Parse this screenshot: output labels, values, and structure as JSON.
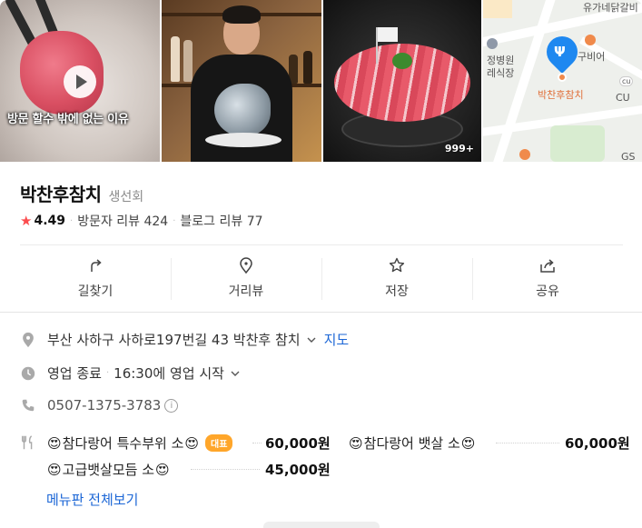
{
  "photos": {
    "video_caption": "방문 할수 밖에 없는 이유",
    "photo_count": "999+",
    "map": {
      "labels": {
        "top_right": "유가네닭갈비",
        "left_mid": "정병원",
        "left_mid2": "레식장",
        "right_mid": "구비어",
        "pin_label": "박찬후참치",
        "cu": "CU",
        "bottom_right": "GS"
      }
    }
  },
  "place": {
    "name": "박찬후참치",
    "category": "생선회",
    "rating": "4.49",
    "visitor_reviews": "방문자 리뷰 424",
    "blog_reviews": "블로그 리뷰 77"
  },
  "actions": {
    "directions": "길찾기",
    "street_view": "거리뷰",
    "save": "저장",
    "share": "공유"
  },
  "info": {
    "address": "부산 사하구 사하로197번길 43 박찬후 참치",
    "map_link": "지도",
    "status": "영업 종료",
    "hours": "16:30에 영업 시작",
    "phone": "0507-1375-3783"
  },
  "menu": {
    "items": [
      {
        "name": "참다랑어 특수부위 소",
        "badge": "대표",
        "price": "60,000원"
      },
      {
        "name": "참다랑어 뱃살 소",
        "price": "60,000원"
      },
      {
        "name": "고급뱃살모듬 소",
        "price": "45,000원"
      }
    ],
    "view_all": "메뉴판 전체보기"
  },
  "colors": {
    "accent_link": "#1b66d6",
    "star": "#fc4c4e",
    "badge": "#ffa62a",
    "map_pin": "#1e88f0"
  }
}
